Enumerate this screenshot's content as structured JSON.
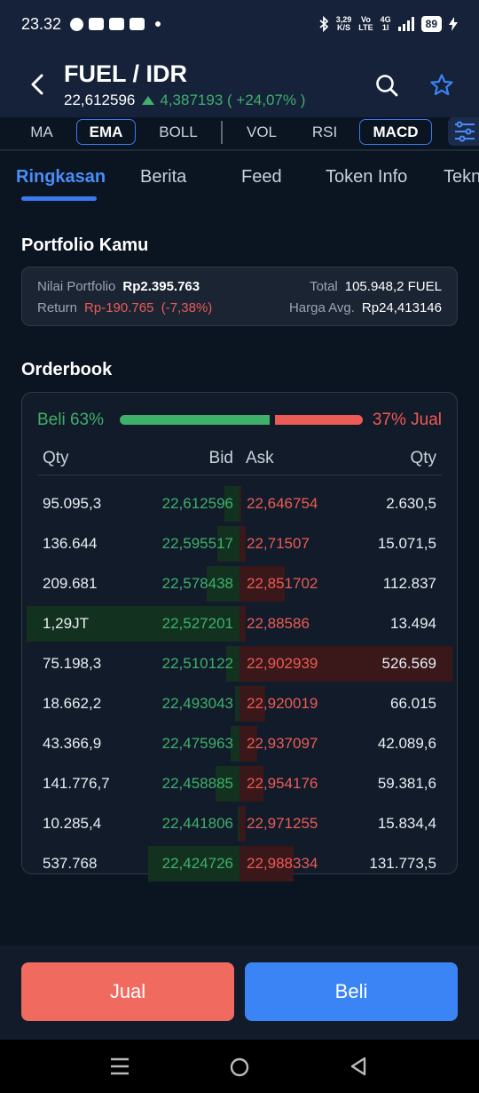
{
  "status_bar": {
    "time": "23.32",
    "net_speed_top": "3,29",
    "net_speed_bottom": "K/S",
    "vo_top": "Vo",
    "vo_bottom": "LTE",
    "net_top": "4G",
    "net_bottom": "1l",
    "battery": "89"
  },
  "header": {
    "pair": "FUEL / IDR",
    "last_price": "22,612596",
    "change": "4,387193 ( +24,07% )"
  },
  "indicators": [
    "MA",
    "EMA",
    "BOLL",
    "VOL",
    "RSI",
    "MACD"
  ],
  "tabs": [
    "Ringkasan",
    "Berita",
    "Feed",
    "Token Info",
    "Tekn"
  ],
  "portfolio": {
    "title": "Portfolio Kamu",
    "value_label": "Nilai Portfolio",
    "value": "Rp2.395.763",
    "return_label": "Return",
    "return_value": "Rp-190.765  (-7,38%)",
    "total_label": "Total",
    "total_value": "105.948,2 FUEL",
    "avg_label": "Harga Avg.",
    "avg_value": "Rp24,413146"
  },
  "orderbook": {
    "title": "Orderbook",
    "buy_ratio": "Beli 63%",
    "sell_ratio": "37% Jual",
    "buy_fraction": 0.63,
    "headers": {
      "qty_bid": "Qty",
      "bid": "Bid",
      "ask": "Ask",
      "qty_ask": "Qty"
    },
    "rows": [
      {
        "bid_qty": "95.095,3",
        "bid": "22,612596",
        "ask": "22,646754",
        "ask_qty": "2.630,5",
        "bid_depth": 0.07,
        "ask_depth": 0.01
      },
      {
        "bid_qty": "136.644",
        "bid": "22,595517",
        "ask": "22,71507",
        "ask_qty": "15.071,5",
        "bid_depth": 0.1,
        "ask_depth": 0.03
      },
      {
        "bid_qty": "209.681",
        "bid": "22,578438",
        "ask": "22,851702",
        "ask_qty": "112.837",
        "bid_depth": 0.15,
        "ask_depth": 0.21
      },
      {
        "bid_qty": "1,29JT",
        "bid": "22,527201",
        "ask": "22,88586",
        "ask_qty": "13.494",
        "bid_depth": 0.98,
        "ask_depth": 0.03
      },
      {
        "bid_qty": "75.198,3",
        "bid": "22,510122",
        "ask": "22,902939",
        "ask_qty": "526.569",
        "bid_depth": 0.06,
        "ask_depth": 0.98
      },
      {
        "bid_qty": "18.662,2",
        "bid": "22,493043",
        "ask": "22,920019",
        "ask_qty": "66.015",
        "bid_depth": 0.02,
        "ask_depth": 0.12
      },
      {
        "bid_qty": "43.366,9",
        "bid": "22,475963",
        "ask": "22,937097",
        "ask_qty": "42.089,6",
        "bid_depth": 0.04,
        "ask_depth": 0.08
      },
      {
        "bid_qty": "141.776,7",
        "bid": "22,458885",
        "ask": "22,954176",
        "ask_qty": "59.381,6",
        "bid_depth": 0.11,
        "ask_depth": 0.11
      },
      {
        "bid_qty": "10.285,4",
        "bid": "22,441806",
        "ask": "22,971255",
        "ask_qty": "15.834,4",
        "bid_depth": 0.01,
        "ask_depth": 0.03
      },
      {
        "bid_qty": "537.768",
        "bid": "22,424726",
        "ask": "22,988334",
        "ask_qty": "131.773,5",
        "bid_depth": 0.42,
        "ask_depth": 0.25
      }
    ]
  },
  "actions": {
    "sell": "Jual",
    "buy": "Beli"
  },
  "colors": {
    "buy": "#3fb06a",
    "sell": "#ec5b55",
    "accent": "#3a7bf0",
    "background": "#0b1421"
  }
}
